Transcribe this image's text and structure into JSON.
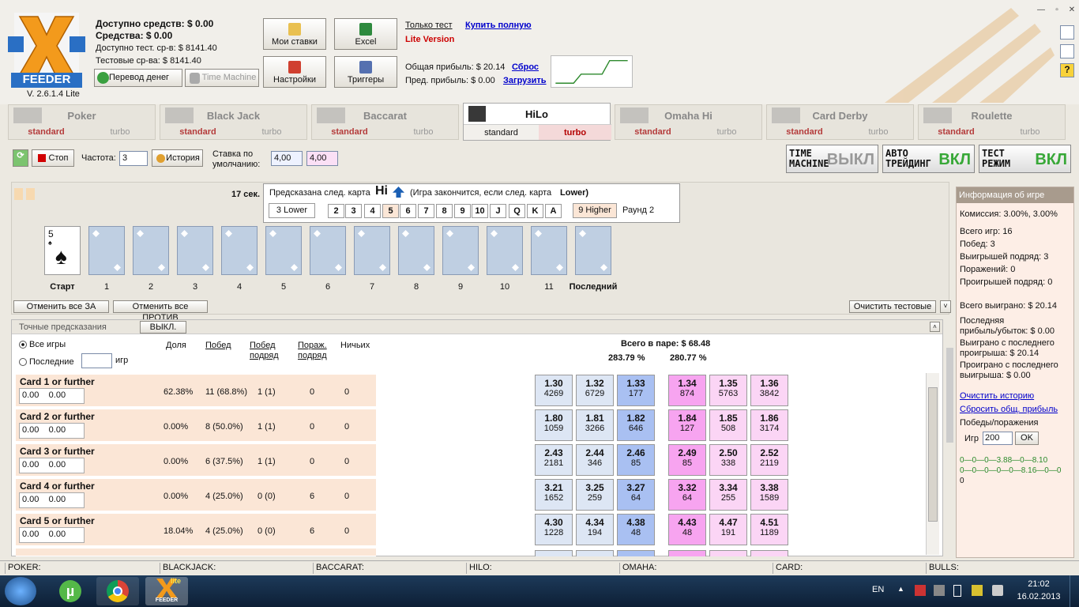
{
  "header": {
    "available": "Доступно средств: $ 0.00",
    "funds": "Средства: $ 0.00",
    "avail_test": "Доступно тест. ср-в: $ 8141.40",
    "test_funds": "Тестовые ср-ва: $ 8141.40",
    "version": "V. 2.6.1.4 Lite",
    "logo_text": "FEEDER",
    "btn_transfer": "Перевод денег",
    "btn_time_machine": "Time Machine",
    "btn_my_bets": "Мои ставки",
    "btn_excel": "Excel",
    "btn_settings": "Настройки",
    "btn_triggers": "Триггеры",
    "only_test": "Только тест",
    "buy_full": "Купить полную",
    "lite_version": "Lite Version",
    "total_profit": "Общая прибыль: $ 20.14",
    "reset": "Сброс",
    "prev_profit": "Пред. прибыль: $ 0.00",
    "load": "Загрузить"
  },
  "tabs": [
    {
      "name": "Poker",
      "std": "standard",
      "turbo": "turbo"
    },
    {
      "name": "Black Jack",
      "std": "standard",
      "turbo": "turbo"
    },
    {
      "name": "Baccarat",
      "std": "standard",
      "turbo": "turbo"
    },
    {
      "name": "HiLo",
      "std": "standard",
      "turbo": "turbo"
    },
    {
      "name": "Omaha Hi",
      "std": "standard",
      "turbo": "turbo"
    },
    {
      "name": "Card Derby",
      "std": "standard",
      "turbo": "turbo"
    },
    {
      "name": "Roulette",
      "std": "standard",
      "turbo": "turbo"
    }
  ],
  "toolbar": {
    "stop": "Стоп",
    "freq_label": "Частота:",
    "freq_value": "3",
    "history": "История",
    "default_bet_label1": "Ставка по",
    "default_bet_label2": "умолчанию:",
    "bet1": "4,00",
    "bet2": "4,00"
  },
  "modes": [
    {
      "l1": "TIME",
      "l2": "MACHINE",
      "state": "ВЫКЛ"
    },
    {
      "l1": "АВТО",
      "l2": "ТРЕЙДИНГ",
      "state": "ВКЛ"
    },
    {
      "l1": "ТЕСТ",
      "l2": "РЕЖИМ",
      "state": "ВКЛ"
    }
  ],
  "game": {
    "timer": "17 сек.",
    "pred_label": "Предсказана след. карта",
    "pred_val": "Hi",
    "pred_note": "(Игра закончится, если след. карта",
    "pred_note_val": "Lower)",
    "lower": "3 Lower",
    "higher": "9 Higher",
    "round": "Раунд 2",
    "ranks": [
      "2",
      "3",
      "4",
      "5",
      "6",
      "7",
      "8",
      "9",
      "10",
      "J",
      "Q",
      "K",
      "A"
    ],
    "start_card": "5",
    "card_labels": [
      "Старт",
      "1",
      "2",
      "3",
      "4",
      "5",
      "6",
      "7",
      "8",
      "9",
      "10",
      "11",
      "Последний"
    ],
    "cancel_for": "Отменить все ЗА",
    "cancel_against": "Отменить все ПРОТИВ",
    "clear_test": "Очистить тестовые"
  },
  "pred": {
    "title": "Точные предсказания",
    "off": "ВЫКЛ.",
    "all_games": "Все игры",
    "last": "Последние",
    "games": "игр",
    "cols": [
      "Доля",
      "Побед",
      "Побед подряд",
      "Пораж. подряд",
      "Ничьих"
    ],
    "total": "Всего в паре: $ 68.48",
    "pct1": "283.79 %",
    "pct2": "280.77 %",
    "rows": [
      {
        "name": "Card 1 or further",
        "v1": "0.00",
        "v2": "0.00",
        "share": "62.38%",
        "wins": "11 (68.8%)",
        "streak": "1 (1)",
        "loss": "0",
        "draw": "0",
        "odds": [
          [
            "1.30",
            "4269"
          ],
          [
            "1.32",
            "6729"
          ],
          [
            "1.33",
            "177"
          ],
          [
            "1.34",
            "874"
          ],
          [
            "1.35",
            "5763"
          ],
          [
            "1.36",
            "3842"
          ]
        ]
      },
      {
        "name": "Card 2 or further",
        "v1": "0.00",
        "v2": "0.00",
        "share": "0.00%",
        "wins": "8 (50.0%)",
        "streak": "1 (1)",
        "loss": "0",
        "draw": "0",
        "odds": [
          [
            "1.80",
            "1059"
          ],
          [
            "1.81",
            "3266"
          ],
          [
            "1.82",
            "646"
          ],
          [
            "1.84",
            "127"
          ],
          [
            "1.85",
            "508"
          ],
          [
            "1.86",
            "3174"
          ]
        ]
      },
      {
        "name": "Card 3 or further",
        "v1": "0.00",
        "v2": "0.00",
        "share": "0.00%",
        "wins": "6 (37.5%)",
        "streak": "1 (1)",
        "loss": "0",
        "draw": "0",
        "odds": [
          [
            "2.43",
            "2181"
          ],
          [
            "2.44",
            "346"
          ],
          [
            "2.46",
            "85"
          ],
          [
            "2.49",
            "85"
          ],
          [
            "2.50",
            "338"
          ],
          [
            "2.52",
            "2119"
          ]
        ]
      },
      {
        "name": "Card 4 or further",
        "v1": "0.00",
        "v2": "0.00",
        "share": "0.00%",
        "wins": "4 (25.0%)",
        "streak": "0 (0)",
        "loss": "6",
        "draw": "0",
        "odds": [
          [
            "3.21",
            "1652"
          ],
          [
            "3.25",
            "259"
          ],
          [
            "3.27",
            "64"
          ],
          [
            "3.32",
            "64"
          ],
          [
            "3.34",
            "255"
          ],
          [
            "3.38",
            "1589"
          ]
        ]
      },
      {
        "name": "Card 5 or further",
        "v1": "0.00",
        "v2": "0.00",
        "share": "18.04%",
        "wins": "4 (25.0%)",
        "streak": "0 (0)",
        "loss": "6",
        "draw": "0",
        "odds": [
          [
            "4.30",
            "1228"
          ],
          [
            "4.34",
            "194"
          ],
          [
            "4.38",
            "48"
          ],
          [
            "4.43",
            "48"
          ],
          [
            "4.47",
            "191"
          ],
          [
            "4.51",
            "1189"
          ]
        ]
      }
    ]
  },
  "info": {
    "title": "Информация об игре",
    "commission": "Комиссия: 3.00%, 3.00%",
    "total_games": "Всего игр: 16",
    "wins": "Побед: 3",
    "win_streak": "Выигрышей подряд: 3",
    "losses": "Поражений: 0",
    "loss_streak": "Проигрышей подряд: 0",
    "total_won": "Всего выиграно: $ 20.14",
    "last_pl1": "Последняя",
    "last_pl2": "прибыль/убыток: $ 0.00",
    "won_since1": "Выиграно с последнего",
    "won_since2": "проигрыша: $ 20.14",
    "lost_since1": "Проиграно с последнего",
    "lost_since2": "выигрыша: $ 0.00",
    "clear_history": "Очистить историю",
    "reset_profit": "Сбросить общ. прибыль",
    "wl": "Победы/поражения",
    "games_label": "Игр",
    "games_value": "200",
    "ok": "OK",
    "seq1": "0—0—0—3.88—0—8.10",
    "seq2": "0—0—0—0—0—8.16—0—0",
    "seq3": "0"
  },
  "status": [
    "POKER:",
    "BLACKJACK:",
    "BACCARAT:",
    "HILO:",
    "OMAHA:",
    "CARD:",
    "BULLS:"
  ],
  "taskbar": {
    "lang": "EN",
    "time": "21:02",
    "date": "16.02.2013",
    "lite": "lite",
    "feeder": "FEEDER"
  },
  "colors": {
    "accent_red": "#c00000",
    "link_blue": "#0000cc",
    "blue_odds": "#a9c0f2",
    "pink_odds": "#f7a4f0"
  }
}
